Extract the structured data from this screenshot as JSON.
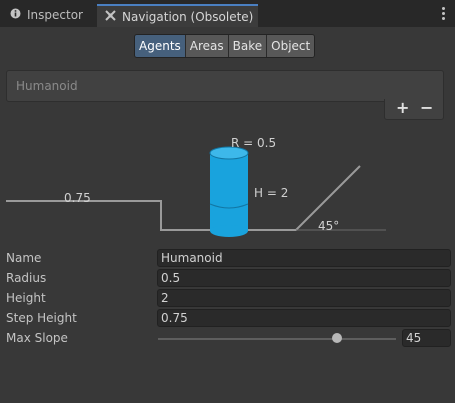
{
  "tabs": [
    {
      "label": "Inspector",
      "icon": "info-icon",
      "active": false
    },
    {
      "label": "Navigation (Obsolete)",
      "icon": "navigation-icon",
      "active": true
    }
  ],
  "toolbar": {
    "segments": [
      "Agents",
      "Areas",
      "Bake",
      "Object"
    ],
    "selected": "Agents"
  },
  "agent_list": {
    "items": [
      "Humanoid"
    ],
    "add_label": "+",
    "remove_label": "−"
  },
  "diagram": {
    "radius_label": "R = 0.5",
    "height_label": "H = 2",
    "step_label": "0.75",
    "slope_label": "45°",
    "cylinder_color": "#19a3dd"
  },
  "fields": {
    "name": {
      "label": "Name",
      "value": "Humanoid"
    },
    "radius": {
      "label": "Radius",
      "value": "0.5"
    },
    "height": {
      "label": "Height",
      "value": "2"
    },
    "step_height": {
      "label": "Step Height",
      "value": "0.75"
    },
    "max_slope": {
      "label": "Max Slope",
      "value": "45",
      "min": 0,
      "max": 60
    }
  },
  "colors": {
    "accent": "#46607c",
    "tab_highlight": "#4a7fc1"
  }
}
